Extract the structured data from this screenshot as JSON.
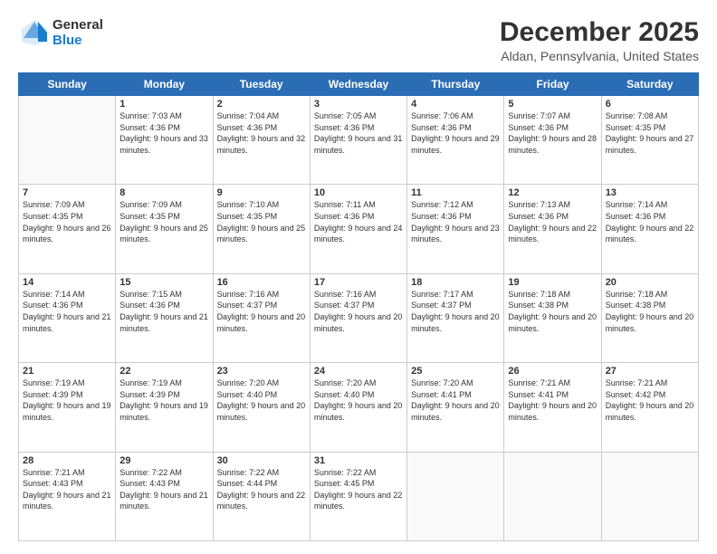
{
  "header": {
    "logo_general": "General",
    "logo_blue": "Blue",
    "title": "December 2025",
    "subtitle": "Aldan, Pennsylvania, United States"
  },
  "calendar": {
    "days_of_week": [
      "Sunday",
      "Monday",
      "Tuesday",
      "Wednesday",
      "Thursday",
      "Friday",
      "Saturday"
    ],
    "weeks": [
      [
        {
          "day": "",
          "sunrise": "",
          "sunset": "",
          "daylight": ""
        },
        {
          "day": "1",
          "sunrise": "Sunrise: 7:03 AM",
          "sunset": "Sunset: 4:36 PM",
          "daylight": "Daylight: 9 hours and 33 minutes."
        },
        {
          "day": "2",
          "sunrise": "Sunrise: 7:04 AM",
          "sunset": "Sunset: 4:36 PM",
          "daylight": "Daylight: 9 hours and 32 minutes."
        },
        {
          "day": "3",
          "sunrise": "Sunrise: 7:05 AM",
          "sunset": "Sunset: 4:36 PM",
          "daylight": "Daylight: 9 hours and 31 minutes."
        },
        {
          "day": "4",
          "sunrise": "Sunrise: 7:06 AM",
          "sunset": "Sunset: 4:36 PM",
          "daylight": "Daylight: 9 hours and 29 minutes."
        },
        {
          "day": "5",
          "sunrise": "Sunrise: 7:07 AM",
          "sunset": "Sunset: 4:36 PM",
          "daylight": "Daylight: 9 hours and 28 minutes."
        },
        {
          "day": "6",
          "sunrise": "Sunrise: 7:08 AM",
          "sunset": "Sunset: 4:35 PM",
          "daylight": "Daylight: 9 hours and 27 minutes."
        }
      ],
      [
        {
          "day": "7",
          "sunrise": "Sunrise: 7:09 AM",
          "sunset": "Sunset: 4:35 PM",
          "daylight": "Daylight: 9 hours and 26 minutes."
        },
        {
          "day": "8",
          "sunrise": "Sunrise: 7:09 AM",
          "sunset": "Sunset: 4:35 PM",
          "daylight": "Daylight: 9 hours and 25 minutes."
        },
        {
          "day": "9",
          "sunrise": "Sunrise: 7:10 AM",
          "sunset": "Sunset: 4:35 PM",
          "daylight": "Daylight: 9 hours and 25 minutes."
        },
        {
          "day": "10",
          "sunrise": "Sunrise: 7:11 AM",
          "sunset": "Sunset: 4:36 PM",
          "daylight": "Daylight: 9 hours and 24 minutes."
        },
        {
          "day": "11",
          "sunrise": "Sunrise: 7:12 AM",
          "sunset": "Sunset: 4:36 PM",
          "daylight": "Daylight: 9 hours and 23 minutes."
        },
        {
          "day": "12",
          "sunrise": "Sunrise: 7:13 AM",
          "sunset": "Sunset: 4:36 PM",
          "daylight": "Daylight: 9 hours and 22 minutes."
        },
        {
          "day": "13",
          "sunrise": "Sunrise: 7:14 AM",
          "sunset": "Sunset: 4:36 PM",
          "daylight": "Daylight: 9 hours and 22 minutes."
        }
      ],
      [
        {
          "day": "14",
          "sunrise": "Sunrise: 7:14 AM",
          "sunset": "Sunset: 4:36 PM",
          "daylight": "Daylight: 9 hours and 21 minutes."
        },
        {
          "day": "15",
          "sunrise": "Sunrise: 7:15 AM",
          "sunset": "Sunset: 4:36 PM",
          "daylight": "Daylight: 9 hours and 21 minutes."
        },
        {
          "day": "16",
          "sunrise": "Sunrise: 7:16 AM",
          "sunset": "Sunset: 4:37 PM",
          "daylight": "Daylight: 9 hours and 20 minutes."
        },
        {
          "day": "17",
          "sunrise": "Sunrise: 7:16 AM",
          "sunset": "Sunset: 4:37 PM",
          "daylight": "Daylight: 9 hours and 20 minutes."
        },
        {
          "day": "18",
          "sunrise": "Sunrise: 7:17 AM",
          "sunset": "Sunset: 4:37 PM",
          "daylight": "Daylight: 9 hours and 20 minutes."
        },
        {
          "day": "19",
          "sunrise": "Sunrise: 7:18 AM",
          "sunset": "Sunset: 4:38 PM",
          "daylight": "Daylight: 9 hours and 20 minutes."
        },
        {
          "day": "20",
          "sunrise": "Sunrise: 7:18 AM",
          "sunset": "Sunset: 4:38 PM",
          "daylight": "Daylight: 9 hours and 20 minutes."
        }
      ],
      [
        {
          "day": "21",
          "sunrise": "Sunrise: 7:19 AM",
          "sunset": "Sunset: 4:39 PM",
          "daylight": "Daylight: 9 hours and 19 minutes."
        },
        {
          "day": "22",
          "sunrise": "Sunrise: 7:19 AM",
          "sunset": "Sunset: 4:39 PM",
          "daylight": "Daylight: 9 hours and 19 minutes."
        },
        {
          "day": "23",
          "sunrise": "Sunrise: 7:20 AM",
          "sunset": "Sunset: 4:40 PM",
          "daylight": "Daylight: 9 hours and 20 minutes."
        },
        {
          "day": "24",
          "sunrise": "Sunrise: 7:20 AM",
          "sunset": "Sunset: 4:40 PM",
          "daylight": "Daylight: 9 hours and 20 minutes."
        },
        {
          "day": "25",
          "sunrise": "Sunrise: 7:20 AM",
          "sunset": "Sunset: 4:41 PM",
          "daylight": "Daylight: 9 hours and 20 minutes."
        },
        {
          "day": "26",
          "sunrise": "Sunrise: 7:21 AM",
          "sunset": "Sunset: 4:41 PM",
          "daylight": "Daylight: 9 hours and 20 minutes."
        },
        {
          "day": "27",
          "sunrise": "Sunrise: 7:21 AM",
          "sunset": "Sunset: 4:42 PM",
          "daylight": "Daylight: 9 hours and 20 minutes."
        }
      ],
      [
        {
          "day": "28",
          "sunrise": "Sunrise: 7:21 AM",
          "sunset": "Sunset: 4:43 PM",
          "daylight": "Daylight: 9 hours and 21 minutes."
        },
        {
          "day": "29",
          "sunrise": "Sunrise: 7:22 AM",
          "sunset": "Sunset: 4:43 PM",
          "daylight": "Daylight: 9 hours and 21 minutes."
        },
        {
          "day": "30",
          "sunrise": "Sunrise: 7:22 AM",
          "sunset": "Sunset: 4:44 PM",
          "daylight": "Daylight: 9 hours and 22 minutes."
        },
        {
          "day": "31",
          "sunrise": "Sunrise: 7:22 AM",
          "sunset": "Sunset: 4:45 PM",
          "daylight": "Daylight: 9 hours and 22 minutes."
        },
        {
          "day": "",
          "sunrise": "",
          "sunset": "",
          "daylight": ""
        },
        {
          "day": "",
          "sunrise": "",
          "sunset": "",
          "daylight": ""
        },
        {
          "day": "",
          "sunrise": "",
          "sunset": "",
          "daylight": ""
        }
      ]
    ]
  }
}
